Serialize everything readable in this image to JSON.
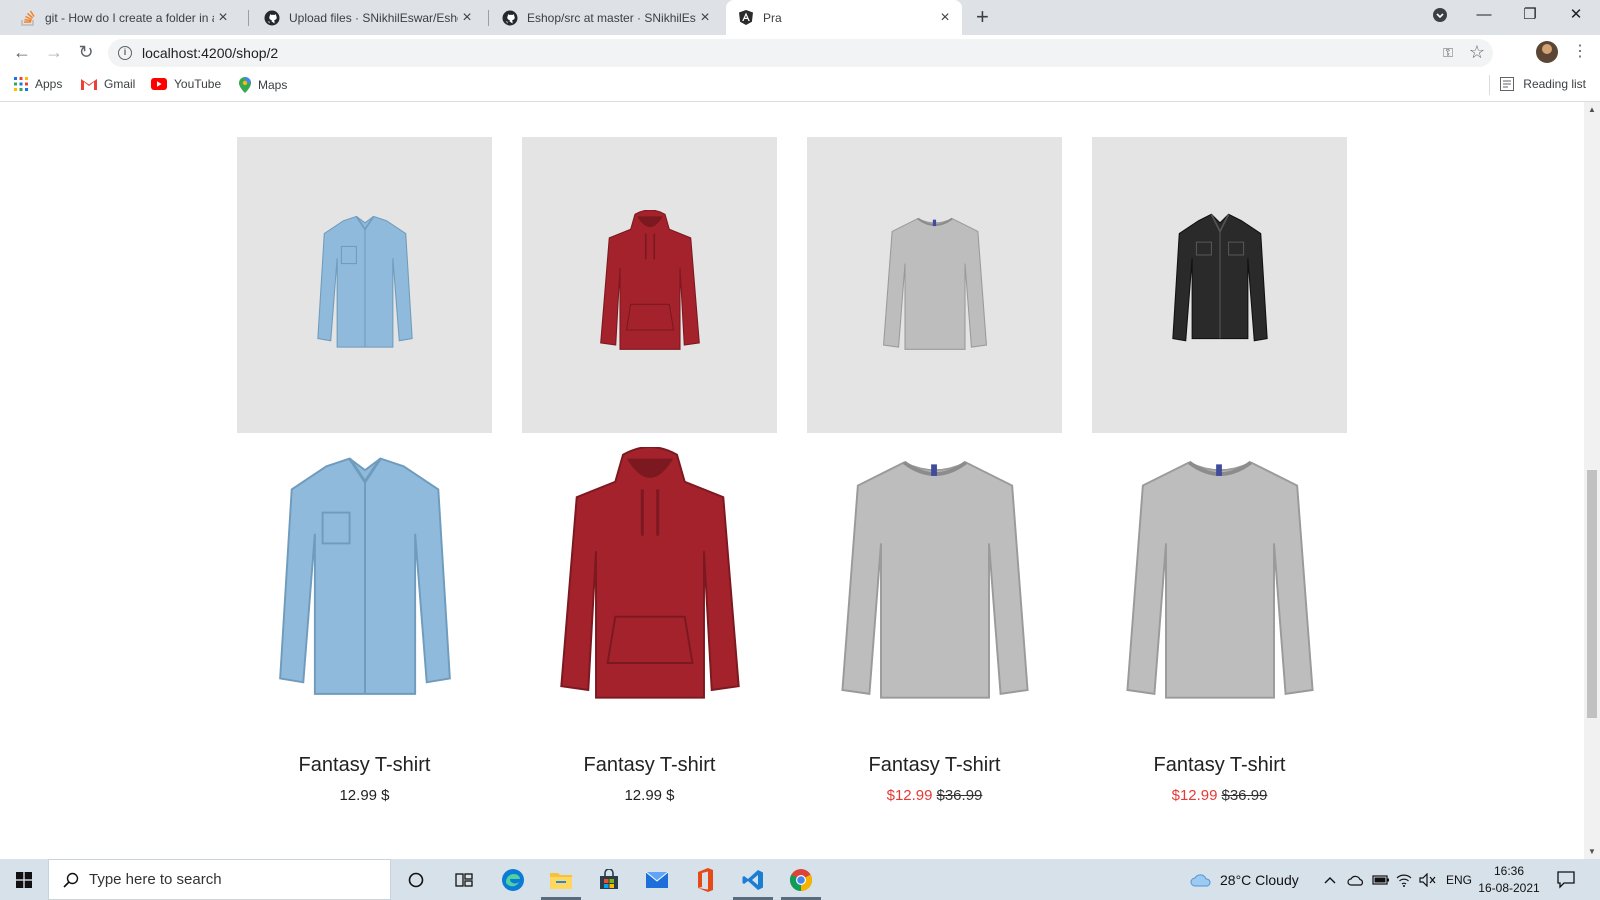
{
  "browser": {
    "tabs": [
      {
        "title": "git - How do I create a folder in a",
        "icon": "stackoverflow-icon"
      },
      {
        "title": "Upload files · SNikhilEswar/Eshop",
        "icon": "github-icon"
      },
      {
        "title": "Eshop/src at master · SNikhilEswa",
        "icon": "github-icon"
      },
      {
        "title": "Pra",
        "icon": "angular-icon",
        "active": true
      }
    ],
    "url": "localhost:4200/shop/2",
    "bookmarks": [
      {
        "label": "Apps",
        "icon": "apps-grid-icon"
      },
      {
        "label": "Gmail",
        "icon": "gmail-icon"
      },
      {
        "label": "YouTube",
        "icon": "youtube-icon"
      },
      {
        "label": "Maps",
        "icon": "maps-pin-icon"
      }
    ],
    "reading_list": "Reading list"
  },
  "products_top": [
    {
      "name": "denim-shirt",
      "color": "#8fbadb"
    },
    {
      "name": "red-hoodie",
      "color": "#a3222b"
    },
    {
      "name": "grey-sweater",
      "color": "#bdbdbd"
    },
    {
      "name": "black-denim-jacket",
      "color": "#2a2a2a"
    }
  ],
  "products": [
    {
      "name": "Fantasy T-shirt",
      "price": "12.99 $",
      "on_sale": false,
      "image": "denim-shirt",
      "color": "#8fbadb"
    },
    {
      "name": "Fantasy T-shirt",
      "price": "12.99 $",
      "on_sale": false,
      "image": "red-hoodie",
      "color": "#a3222b"
    },
    {
      "name": "Fantasy T-shirt",
      "sale_price": "$12.99",
      "old_price": "$36.99",
      "on_sale": true,
      "image": "grey-sweater",
      "color": "#bdbdbd"
    },
    {
      "name": "Fantasy T-shirt",
      "sale_price": "$12.99",
      "old_price": "$36.99",
      "on_sale": true,
      "image": "grey-sweater",
      "color": "#bdbdbd"
    }
  ],
  "taskbar": {
    "search_placeholder": "Type here to search",
    "weather": "28°C  Cloudy",
    "language": "ENG",
    "time": "16:36",
    "date": "16-08-2021"
  },
  "colors": {
    "sale": "#e53935",
    "tab_strip": "#dee1e6",
    "taskbar": "#d7e1ea"
  }
}
